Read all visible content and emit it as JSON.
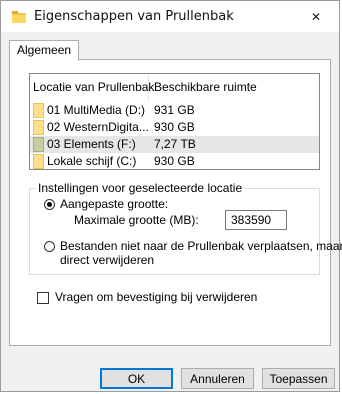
{
  "window": {
    "title": "Eigenschappen van Prullenbak",
    "close_glyph": "✕"
  },
  "tabs": [
    {
      "label": "Algemeen",
      "selected": true
    }
  ],
  "listview": {
    "columns": [
      "Locatie van Prullenbak",
      "Beschikbare ruimte"
    ],
    "rows": [
      {
        "name": "01 MultiMedia (D:)",
        "space": "931 GB",
        "icon": "drive-folder-icon",
        "selected": false
      },
      {
        "name": "02 WesternDigita...",
        "space": "930 GB",
        "icon": "drive-folder-icon",
        "selected": false
      },
      {
        "name": "03 Elements (F:)",
        "space": "7,27 TB",
        "icon": "drive-folder-icon",
        "selected": true
      },
      {
        "name": "Lokale schijf (C:)",
        "space": "930 GB",
        "icon": "drive-folder-icon",
        "selected": false
      }
    ]
  },
  "settings": {
    "legend": "Instellingen voor geselecteerde locatie",
    "custom_size_label": "Aangepaste grootte:",
    "max_size_label": "Maximale grootte (MB):",
    "max_size_value": "383590",
    "no_recycle_line1": "Bestanden niet naar de Prullenbak verplaatsen, maar",
    "no_recycle_line2": "direct verwijderen",
    "confirm_delete_label": "Vragen om bevestiging bij verwijderen"
  },
  "buttons": {
    "ok": "OK",
    "cancel": "Annuleren",
    "apply": "Toepassen"
  },
  "colors": {
    "folder": "#ffe08a",
    "selected_row": "#e6e6e6",
    "accent": "#0078d7"
  }
}
